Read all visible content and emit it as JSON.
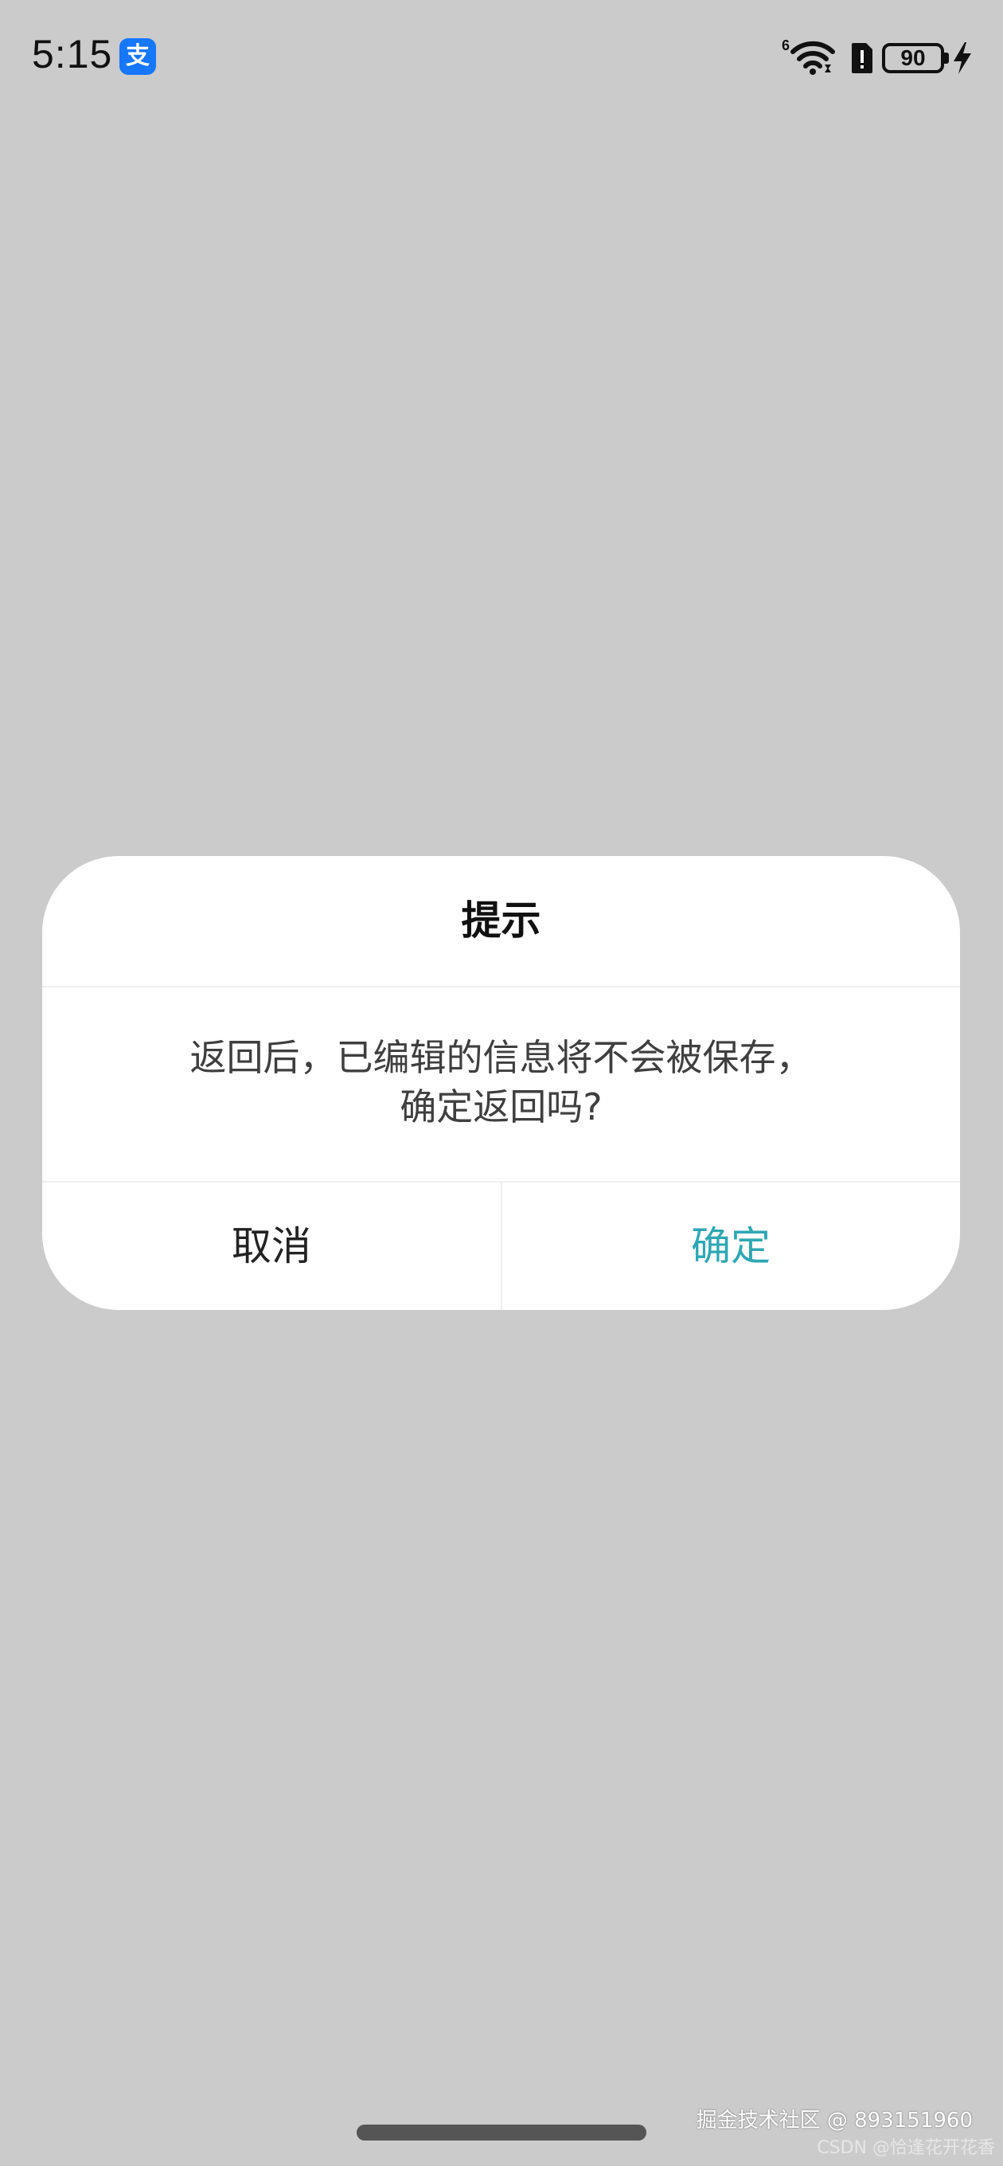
{
  "status_bar": {
    "time": "5:15",
    "app_icon": "支",
    "network_tag": "6",
    "battery_level": "90",
    "icons": [
      "alipay-icon",
      "wifi-icon",
      "sim-alert-icon",
      "battery-icon",
      "charging-icon"
    ]
  },
  "dialog": {
    "title": "提示",
    "message_line1": "返回后，已编辑的信息将不会被保存，",
    "message_line2": "确定返回吗?",
    "cancel_label": "取消",
    "confirm_label": "确定",
    "confirm_color": "#2ea7b3"
  },
  "watermark": {
    "line1": "掘金技术社区 @ 893151960",
    "line2": "CSDN @恰逢花开花香"
  },
  "colors": {
    "background": "#cbcbcb",
    "dialog": "#ffffff",
    "alipay": "#1677ff"
  }
}
